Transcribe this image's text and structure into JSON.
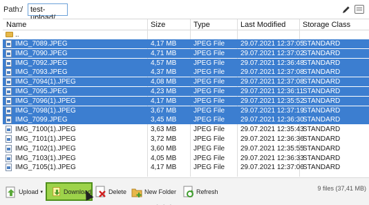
{
  "pathbar": {
    "label": "Path:",
    "root": "/",
    "value": "test-upload/"
  },
  "table": {
    "columns": [
      "Name",
      "Size",
      "Type",
      "Last Modified",
      "Storage Class"
    ],
    "parent_row": "..",
    "rows": [
      {
        "name": "IMG_7089.JPEG",
        "size": "4,17 MB",
        "type": "JPEG File",
        "modified": "29.07.2021 12:37:05",
        "class": "STANDARD",
        "selected": true
      },
      {
        "name": "IMG_7090.JPEG",
        "size": "4,71 MB",
        "type": "JPEG File",
        "modified": "29.07.2021 12:37:02",
        "class": "STANDARD",
        "selected": true
      },
      {
        "name": "IMG_7092.JPEG",
        "size": "4,57 MB",
        "type": "JPEG File",
        "modified": "29.07.2021 12:36:48",
        "class": "STANDARD",
        "selected": true
      },
      {
        "name": "IMG_7093.JPEG",
        "size": "4,37 MB",
        "type": "JPEG File",
        "modified": "29.07.2021 12:37:08",
        "class": "STANDARD",
        "selected": true
      },
      {
        "name": "IMG_7094(1).JPEG",
        "size": "4,08 MB",
        "type": "JPEG File",
        "modified": "29.07.2021 12:37:08",
        "class": "STANDARD",
        "selected": true
      },
      {
        "name": "IMG_7095.JPEG",
        "size": "4,23 MB",
        "type": "JPEG File",
        "modified": "29.07.2021 12:36:11",
        "class": "STANDARD",
        "selected": true
      },
      {
        "name": "IMG_7096(1).JPEG",
        "size": "4,17 MB",
        "type": "JPEG File",
        "modified": "29.07.2021 12:35:52",
        "class": "STANDARD",
        "selected": true
      },
      {
        "name": "IMG_7098(1).JPEG",
        "size": "3,67 MB",
        "type": "JPEG File",
        "modified": "29.07.2021 12:37:19",
        "class": "STANDARD",
        "selected": true
      },
      {
        "name": "IMG_7099.JPEG",
        "size": "3,45 MB",
        "type": "JPEG File",
        "modified": "29.07.2021 12:36:30",
        "class": "STANDARD",
        "selected": true
      },
      {
        "name": "IMG_7100(1).JPEG",
        "size": "3,63 MB",
        "type": "JPEG File",
        "modified": "29.07.2021 12:35:43",
        "class": "STANDARD",
        "selected": false
      },
      {
        "name": "IMG_7101(1).JPEG",
        "size": "3,72 MB",
        "type": "JPEG File",
        "modified": "29.07.2021 12:36:36",
        "class": "STANDARD",
        "selected": false
      },
      {
        "name": "IMG_7102(1).JPEG",
        "size": "3,60 MB",
        "type": "JPEG File",
        "modified": "29.07.2021 12:35:55",
        "class": "STANDARD",
        "selected": false
      },
      {
        "name": "IMG_7103(1).JPEG",
        "size": "4,05 MB",
        "type": "JPEG File",
        "modified": "29.07.2021 12:36:33",
        "class": "STANDARD",
        "selected": false
      },
      {
        "name": "IMG_7105(1).JPEG",
        "size": "4,17 MB",
        "type": "JPEG File",
        "modified": "29.07.2021 12:37:06",
        "class": "STANDARD",
        "selected": false
      }
    ]
  },
  "toolbar": {
    "upload_label": "Upload",
    "download_label": "Download",
    "delete_label": "Delete",
    "new_folder_label": "New Folder",
    "refresh_label": "Refresh",
    "status": "9 files (37,41 MB)",
    "grip": "• • •"
  },
  "colors": {
    "selection": "#3c7ed0",
    "active_button": "#9dd34a",
    "active_border": "#4f8f1b"
  },
  "icons": [
    "folder-icon",
    "file-icon",
    "edit-icon",
    "view-icon",
    "upload-icon",
    "download-icon",
    "delete-icon",
    "new-folder-icon",
    "refresh-icon"
  ]
}
